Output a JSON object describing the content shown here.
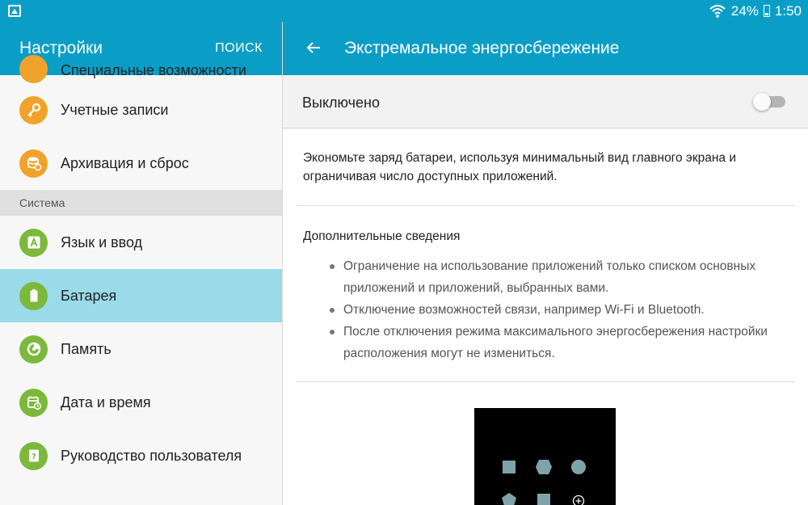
{
  "status_bar": {
    "battery_percent": "24%",
    "time": "1:50"
  },
  "sidebar": {
    "title": "Настройки",
    "search_label": "ПОИСК",
    "partial_item": "Специальные возможности",
    "items_top": [
      {
        "label": "Учетные записи",
        "icon": "key-icon"
      },
      {
        "label": "Архивация и сброс",
        "icon": "backup-icon"
      }
    ],
    "section": "Система",
    "items_system": [
      {
        "label": "Язык и ввод",
        "icon": "language-icon"
      },
      {
        "label": "Батарея",
        "icon": "battery-icon",
        "active": true
      },
      {
        "label": "Память",
        "icon": "memory-icon"
      },
      {
        "label": "Дата и время",
        "icon": "calendar-clock-icon"
      },
      {
        "label": "Руководство пользователя",
        "icon": "user-manual-icon"
      }
    ]
  },
  "main": {
    "title": "Экстремальное энергосбережение",
    "toggle_label": "Выключено",
    "toggle_on": false,
    "description": "Экономьте заряд батареи, используя минимальный вид главного экрана и ограничивая число доступных приложений.",
    "more_title": "Дополнительные сведения",
    "bullets": [
      "Ограничение на использование приложений только списком основных приложений и приложений, выбранных вами.",
      "Отключение возможностей связи, например Wi-Fi и Bluetooth.",
      "После отключения режима максимального энергосбережения настройки расположения могут не измениться."
    ]
  },
  "colors": {
    "header": "#0a9ec6",
    "active_item": "#99dbe8",
    "icon_green": "#7cb93b",
    "icon_orange": "#f0a32a"
  }
}
